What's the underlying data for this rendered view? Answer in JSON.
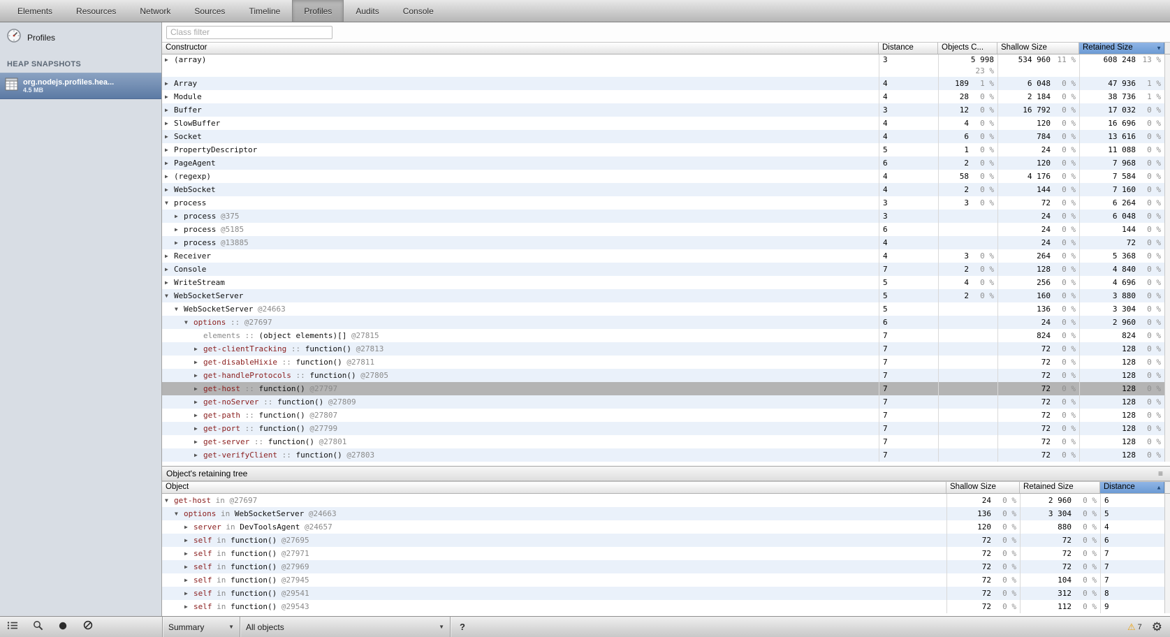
{
  "tabs": [
    "Elements",
    "Resources",
    "Network",
    "Sources",
    "Timeline",
    "Profiles",
    "Audits",
    "Console"
  ],
  "selected_tab": "Profiles",
  "sidebar": {
    "panel_title": "Profiles",
    "section": "HEAP SNAPSHOTS",
    "snapshots": [
      {
        "name": "org.nodejs.profiles.hea...",
        "size": "4.5 MB",
        "selected": true
      }
    ]
  },
  "filter": {
    "placeholder": "Class filter"
  },
  "heap_table": {
    "columns": [
      {
        "label": "Constructor"
      },
      {
        "label": "Distance"
      },
      {
        "label": "Objects C..."
      },
      {
        "label": "Shallow Size"
      },
      {
        "label": "Retained Size",
        "sorted": "desc"
      }
    ],
    "rows": [
      {
        "l": 0,
        "a": "c",
        "s": [
          [
            "(array)",
            "n"
          ]
        ],
        "d": "3",
        "o": "5 998",
        "op": "",
        "op2": "23 %",
        "sh": "534 960",
        "shp": "11 %",
        "re": "608 248",
        "rep": "13 %"
      },
      {
        "l": 0,
        "a": "c",
        "s": [
          [
            "Array",
            "n"
          ]
        ],
        "d": "4",
        "o": "189",
        "op": "1 %",
        "sh": "6 048",
        "shp": "0 %",
        "re": "47 936",
        "rep": "1 %"
      },
      {
        "l": 0,
        "a": "c",
        "s": [
          [
            "Module",
            "n"
          ]
        ],
        "d": "4",
        "o": "28",
        "op": "0 %",
        "sh": "2 184",
        "shp": "0 %",
        "re": "38 736",
        "rep": "1 %"
      },
      {
        "l": 0,
        "a": "c",
        "s": [
          [
            "Buffer",
            "n"
          ]
        ],
        "d": "3",
        "o": "12",
        "op": "0 %",
        "sh": "16 792",
        "shp": "0 %",
        "re": "17 032",
        "rep": "0 %"
      },
      {
        "l": 0,
        "a": "c",
        "s": [
          [
            "SlowBuffer",
            "n"
          ]
        ],
        "d": "4",
        "o": "4",
        "op": "0 %",
        "sh": "120",
        "shp": "0 %",
        "re": "16 696",
        "rep": "0 %"
      },
      {
        "l": 0,
        "a": "c",
        "s": [
          [
            "Socket",
            "n"
          ]
        ],
        "d": "4",
        "o": "6",
        "op": "0 %",
        "sh": "784",
        "shp": "0 %",
        "re": "13 616",
        "rep": "0 %"
      },
      {
        "l": 0,
        "a": "c",
        "s": [
          [
            "PropertyDescriptor",
            "n"
          ]
        ],
        "d": "5",
        "o": "1",
        "op": "0 %",
        "sh": "24",
        "shp": "0 %",
        "re": "11 088",
        "rep": "0 %"
      },
      {
        "l": 0,
        "a": "c",
        "s": [
          [
            "PageAgent",
            "n"
          ]
        ],
        "d": "6",
        "o": "2",
        "op": "0 %",
        "sh": "120",
        "shp": "0 %",
        "re": "7 968",
        "rep": "0 %"
      },
      {
        "l": 0,
        "a": "c",
        "s": [
          [
            "(regexp)",
            "n"
          ]
        ],
        "d": "4",
        "o": "58",
        "op": "0 %",
        "sh": "4 176",
        "shp": "0 %",
        "re": "7 584",
        "rep": "0 %"
      },
      {
        "l": 0,
        "a": "c",
        "s": [
          [
            "WebSocket",
            "n"
          ]
        ],
        "d": "4",
        "o": "2",
        "op": "0 %",
        "sh": "144",
        "shp": "0 %",
        "re": "7 160",
        "rep": "0 %"
      },
      {
        "l": 0,
        "a": "e",
        "s": [
          [
            "process",
            "n"
          ]
        ],
        "d": "3",
        "o": "3",
        "op": "0 %",
        "sh": "72",
        "shp": "0 %",
        "re": "6 264",
        "rep": "0 %"
      },
      {
        "l": 1,
        "a": "c",
        "s": [
          [
            "process ",
            "n"
          ],
          [
            "@375",
            "g"
          ]
        ],
        "d": "3",
        "sh": "24",
        "shp": "0 %",
        "re": "6 048",
        "rep": "0 %"
      },
      {
        "l": 1,
        "a": "c",
        "s": [
          [
            "process ",
            "n"
          ],
          [
            "@5185",
            "g"
          ]
        ],
        "d": "6",
        "sh": "24",
        "shp": "0 %",
        "re": "144",
        "rep": "0 %"
      },
      {
        "l": 1,
        "a": "c",
        "s": [
          [
            "process ",
            "n"
          ],
          [
            "@13885",
            "g"
          ]
        ],
        "d": "4",
        "sh": "24",
        "shp": "0 %",
        "re": "72",
        "rep": "0 %"
      },
      {
        "l": 0,
        "a": "c",
        "s": [
          [
            "Receiver",
            "n"
          ]
        ],
        "d": "4",
        "o": "3",
        "op": "0 %",
        "sh": "264",
        "shp": "0 %",
        "re": "5 368",
        "rep": "0 %"
      },
      {
        "l": 0,
        "a": "c",
        "s": [
          [
            "Console",
            "n"
          ]
        ],
        "d": "7",
        "o": "2",
        "op": "0 %",
        "sh": "128",
        "shp": "0 %",
        "re": "4 840",
        "rep": "0 %"
      },
      {
        "l": 0,
        "a": "c",
        "s": [
          [
            "WriteStream",
            "n"
          ]
        ],
        "d": "5",
        "o": "4",
        "op": "0 %",
        "sh": "256",
        "shp": "0 %",
        "re": "4 696",
        "rep": "0 %"
      },
      {
        "l": 0,
        "a": "e",
        "s": [
          [
            "WebSocketServer",
            "n"
          ]
        ],
        "d": "5",
        "o": "2",
        "op": "0 %",
        "sh": "160",
        "shp": "0 %",
        "re": "3 880",
        "rep": "0 %"
      },
      {
        "l": 1,
        "a": "e",
        "s": [
          [
            "WebSocketServer ",
            "n"
          ],
          [
            "@24663",
            "g"
          ]
        ],
        "d": "5",
        "sh": "136",
        "shp": "0 %",
        "re": "3 304",
        "rep": "0 %"
      },
      {
        "l": 2,
        "a": "e",
        "s": [
          [
            "options",
            "p"
          ],
          [
            " :: ",
            "g"
          ],
          [
            "@27697",
            "g"
          ]
        ],
        "d": "6",
        "sh": "24",
        "shp": "0 %",
        "re": "2 960",
        "rep": "0 %"
      },
      {
        "l": 3,
        "a": "",
        "s": [
          [
            "elements :: ",
            "g"
          ],
          [
            "(object elements)[] ",
            "n"
          ],
          [
            "@27815",
            "g"
          ]
        ],
        "d": "7",
        "sh": "824",
        "shp": "0 %",
        "re": "824",
        "rep": "0 %"
      },
      {
        "l": 3,
        "a": "c",
        "s": [
          [
            "get-clientTracking",
            "p"
          ],
          [
            " :: ",
            "g"
          ],
          [
            "function() ",
            "n"
          ],
          [
            "@27813",
            "g"
          ]
        ],
        "d": "7",
        "sh": "72",
        "shp": "0 %",
        "re": "128",
        "rep": "0 %"
      },
      {
        "l": 3,
        "a": "c",
        "s": [
          [
            "get-disableHixie",
            "p"
          ],
          [
            " :: ",
            "g"
          ],
          [
            "function() ",
            "n"
          ],
          [
            "@27811",
            "g"
          ]
        ],
        "d": "7",
        "sh": "72",
        "shp": "0 %",
        "re": "128",
        "rep": "0 %"
      },
      {
        "l": 3,
        "a": "c",
        "s": [
          [
            "get-handleProtocols",
            "p"
          ],
          [
            " :: ",
            "g"
          ],
          [
            "function() ",
            "n"
          ],
          [
            "@27805",
            "g"
          ]
        ],
        "d": "7",
        "sh": "72",
        "shp": "0 %",
        "re": "128",
        "rep": "0 %"
      },
      {
        "l": 3,
        "a": "c",
        "sel": true,
        "s": [
          [
            "get-host",
            "p"
          ],
          [
            " :: ",
            "g"
          ],
          [
            "function() ",
            "n"
          ],
          [
            "@27797",
            "g"
          ]
        ],
        "d": "7",
        "sh": "72",
        "shp": "0 %",
        "re": "128",
        "rep": "0 %"
      },
      {
        "l": 3,
        "a": "c",
        "s": [
          [
            "get-noServer",
            "p"
          ],
          [
            " :: ",
            "g"
          ],
          [
            "function() ",
            "n"
          ],
          [
            "@27809",
            "g"
          ]
        ],
        "d": "7",
        "sh": "72",
        "shp": "0 %",
        "re": "128",
        "rep": "0 %"
      },
      {
        "l": 3,
        "a": "c",
        "s": [
          [
            "get-path",
            "p"
          ],
          [
            " :: ",
            "g"
          ],
          [
            "function() ",
            "n"
          ],
          [
            "@27807",
            "g"
          ]
        ],
        "d": "7",
        "sh": "72",
        "shp": "0 %",
        "re": "128",
        "rep": "0 %"
      },
      {
        "l": 3,
        "a": "c",
        "s": [
          [
            "get-port",
            "p"
          ],
          [
            " :: ",
            "g"
          ],
          [
            "function() ",
            "n"
          ],
          [
            "@27799",
            "g"
          ]
        ],
        "d": "7",
        "sh": "72",
        "shp": "0 %",
        "re": "128",
        "rep": "0 %"
      },
      {
        "l": 3,
        "a": "c",
        "s": [
          [
            "get-server",
            "p"
          ],
          [
            " :: ",
            "g"
          ],
          [
            "function() ",
            "n"
          ],
          [
            "@27801",
            "g"
          ]
        ],
        "d": "7",
        "sh": "72",
        "shp": "0 %",
        "re": "128",
        "rep": "0 %"
      },
      {
        "l": 3,
        "a": "c",
        "s": [
          [
            "get-verifyClient",
            "p"
          ],
          [
            " :: ",
            "g"
          ],
          [
            "function() ",
            "n"
          ],
          [
            "@27803",
            "g"
          ]
        ],
        "d": "7",
        "sh": "72",
        "shp": "0 %",
        "re": "128",
        "rep": "0 %"
      }
    ]
  },
  "retaining": {
    "title": "Object's retaining tree",
    "columns": [
      {
        "label": "Object"
      },
      {
        "label": "Shallow Size"
      },
      {
        "label": "Retained Size"
      },
      {
        "label": "Distance",
        "sorted": "asc"
      }
    ],
    "rows": [
      {
        "l": 0,
        "a": "e",
        "s": [
          [
            "get-host",
            "p"
          ],
          [
            " in ",
            "g"
          ],
          [
            "@27697",
            "g"
          ]
        ],
        "sh": "24",
        "shp": "0 %",
        "re": "2 960",
        "rep": "0 %",
        "d": "6"
      },
      {
        "l": 1,
        "a": "e",
        "s": [
          [
            "options",
            "p"
          ],
          [
            " in ",
            "g"
          ],
          [
            "WebSocketServer ",
            "n"
          ],
          [
            "@24663",
            "g"
          ]
        ],
        "sh": "136",
        "shp": "0 %",
        "re": "3 304",
        "rep": "0 %",
        "d": "5"
      },
      {
        "l": 2,
        "a": "c",
        "s": [
          [
            "server",
            "p"
          ],
          [
            " in ",
            "g"
          ],
          [
            "DevToolsAgent ",
            "n"
          ],
          [
            "@24657",
            "g"
          ]
        ],
        "sh": "120",
        "shp": "0 %",
        "re": "880",
        "rep": "0 %",
        "d": "4"
      },
      {
        "l": 2,
        "a": "c",
        "s": [
          [
            "self",
            "p"
          ],
          [
            " in ",
            "g"
          ],
          [
            "function() ",
            "n"
          ],
          [
            "@27695",
            "g"
          ]
        ],
        "sh": "72",
        "shp": "0 %",
        "re": "72",
        "rep": "0 %",
        "d": "6"
      },
      {
        "l": 2,
        "a": "c",
        "s": [
          [
            "self",
            "p"
          ],
          [
            " in ",
            "g"
          ],
          [
            "function() ",
            "n"
          ],
          [
            "@27971",
            "g"
          ]
        ],
        "sh": "72",
        "shp": "0 %",
        "re": "72",
        "rep": "0 %",
        "d": "7"
      },
      {
        "l": 2,
        "a": "c",
        "s": [
          [
            "self",
            "p"
          ],
          [
            " in ",
            "g"
          ],
          [
            "function() ",
            "n"
          ],
          [
            "@27969",
            "g"
          ]
        ],
        "sh": "72",
        "shp": "0 %",
        "re": "72",
        "rep": "0 %",
        "d": "7"
      },
      {
        "l": 2,
        "a": "c",
        "s": [
          [
            "self",
            "p"
          ],
          [
            " in ",
            "g"
          ],
          [
            "function() ",
            "n"
          ],
          [
            "@27945",
            "g"
          ]
        ],
        "sh": "72",
        "shp": "0 %",
        "re": "104",
        "rep": "0 %",
        "d": "7"
      },
      {
        "l": 2,
        "a": "c",
        "s": [
          [
            "self",
            "p"
          ],
          [
            " in ",
            "g"
          ],
          [
            "function() ",
            "n"
          ],
          [
            "@29541",
            "g"
          ]
        ],
        "sh": "72",
        "shp": "0 %",
        "re": "312",
        "rep": "0 %",
        "d": "8"
      },
      {
        "l": 2,
        "a": "c",
        "s": [
          [
            "self",
            "p"
          ],
          [
            " in ",
            "g"
          ],
          [
            "function() ",
            "n"
          ],
          [
            "@29543",
            "g"
          ]
        ],
        "sh": "72",
        "shp": "0 %",
        "re": "112",
        "rep": "0 %",
        "d": "9"
      }
    ]
  },
  "statusbar": {
    "summary": "Summary",
    "scope": "All objects",
    "help": "?",
    "warnings": "7"
  },
  "colors": {
    "sorted_header": "#6c9bd4",
    "selected_row": "#b4b4b4",
    "row_stripe": "#eaf1fa",
    "sidebar_selection": "#5c7aa4",
    "property_name": "#8b2020",
    "warning": "#eba312"
  }
}
